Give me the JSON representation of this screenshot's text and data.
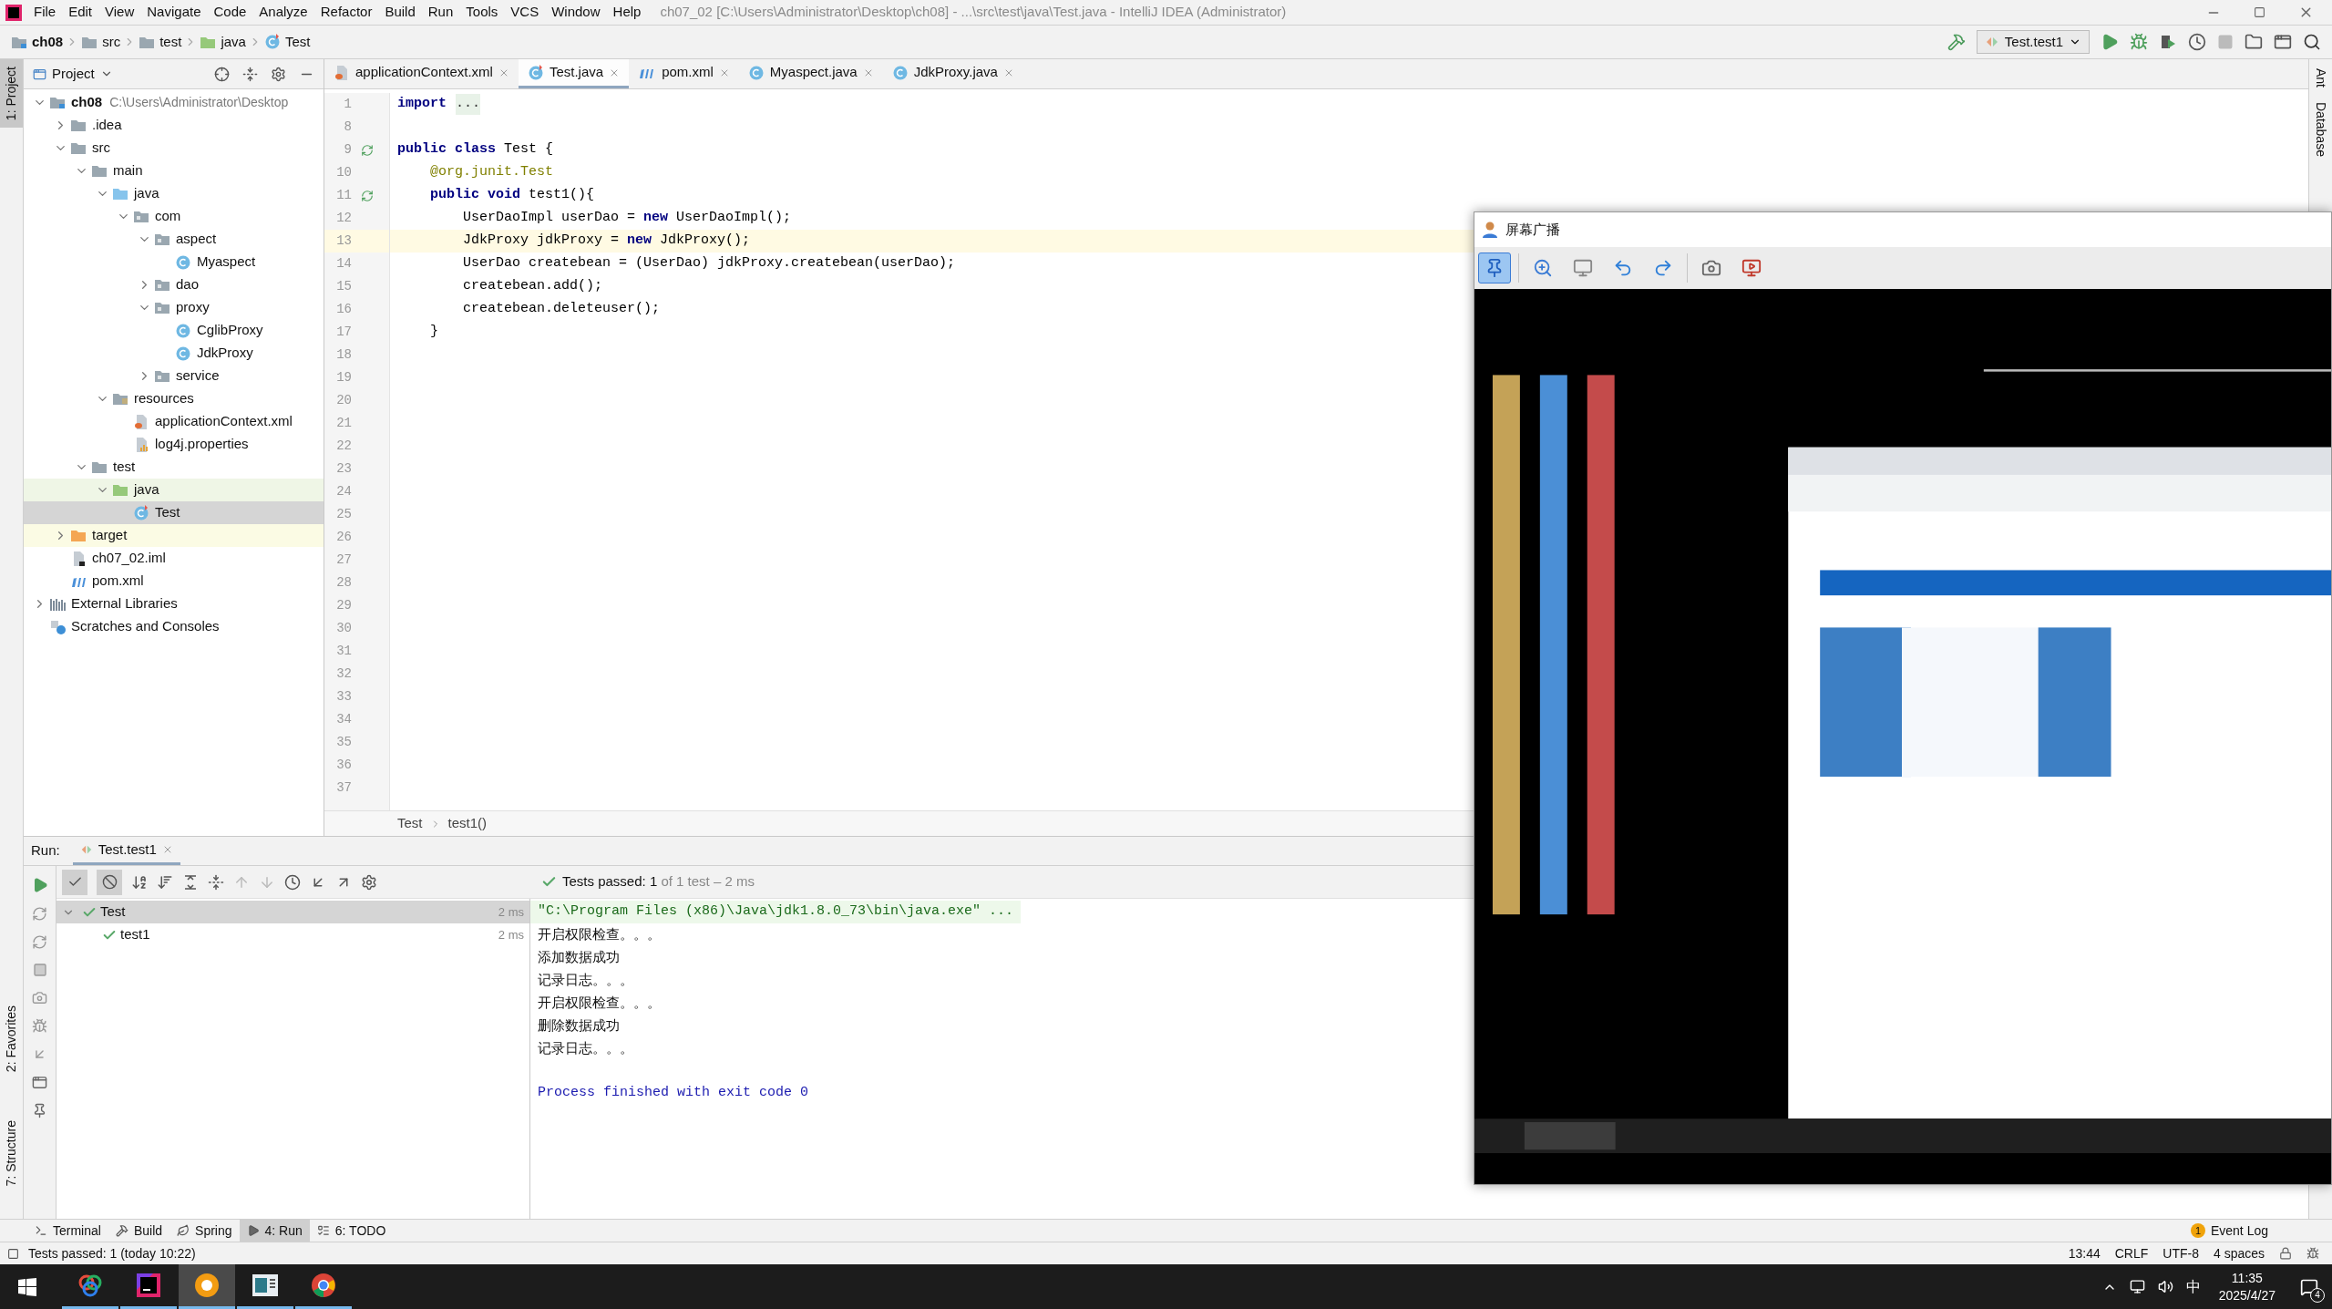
{
  "window": {
    "title": "ch07_02 [C:\\Users\\Administrator\\Desktop\\ch08] - ...\\src\\test\\java\\Test.java - IntelliJ IDEA (Administrator)"
  },
  "menu": [
    "File",
    "Edit",
    "View",
    "Navigate",
    "Code",
    "Analyze",
    "Refactor",
    "Build",
    "Run",
    "Tools",
    "VCS",
    "Window",
    "Help"
  ],
  "breadcrumbs": [
    {
      "label": "ch08",
      "kind": "module"
    },
    {
      "label": "src",
      "kind": "folder"
    },
    {
      "label": "test",
      "kind": "folder"
    },
    {
      "label": "java",
      "kind": "test_source"
    },
    {
      "label": "Test",
      "kind": "test_class"
    }
  ],
  "run_config": "Test.test1",
  "left_stripe": [
    {
      "label": "1: Project",
      "selected": true
    },
    {
      "label": "2: Favorites",
      "selected": false
    },
    {
      "label": "7: Structure",
      "selected": false
    }
  ],
  "right_stripe": [
    "Ant",
    "Database"
  ],
  "project_panel": {
    "title": "Project",
    "tree": [
      {
        "label": "ch08",
        "path": "C:\\Users\\Administrator\\Desktop",
        "kind": "module",
        "expanded": true,
        "selected": false,
        "children": [
          {
            "label": ".idea",
            "kind": "folder",
            "expanded": false,
            "selected": false
          },
          {
            "label": "src",
            "kind": "folder",
            "expanded": true,
            "selected": false,
            "children": [
              {
                "label": "main",
                "kind": "folder",
                "expanded": true,
                "selected": false,
                "children": [
                  {
                    "label": "java",
                    "kind": "source",
                    "expanded": true,
                    "selected": false,
                    "children": [
                      {
                        "label": "com",
                        "kind": "package",
                        "expanded": true,
                        "selected": false,
                        "children": [
                          {
                            "label": "aspect",
                            "kind": "package",
                            "expanded": true,
                            "selected": false,
                            "children": [
                              {
                                "label": "Myaspect",
                                "kind": "class",
                                "selected": false
                              }
                            ]
                          },
                          {
                            "label": "dao",
                            "kind": "package",
                            "expanded": false,
                            "selected": false
                          },
                          {
                            "label": "proxy",
                            "kind": "package",
                            "expanded": true,
                            "selected": false,
                            "children": [
                              {
                                "label": "CglibProxy",
                                "kind": "class",
                                "selected": false
                              },
                              {
                                "label": "JdkProxy",
                                "kind": "class",
                                "selected": false
                              }
                            ]
                          },
                          {
                            "label": "service",
                            "kind": "package",
                            "expanded": false,
                            "selected": false
                          }
                        ]
                      }
                    ]
                  },
                  {
                    "label": "resources",
                    "kind": "resources",
                    "expanded": true,
                    "selected": false,
                    "children": [
                      {
                        "label": "applicationContext.xml",
                        "kind": "xml",
                        "selected": false
                      },
                      {
                        "label": "log4j.properties",
                        "kind": "properties",
                        "selected": false
                      }
                    ]
                  }
                ]
              },
              {
                "label": "test",
                "kind": "folder",
                "expanded": true,
                "selected": false,
                "children": [
                  {
                    "label": "java",
                    "kind": "test_source",
                    "expanded": true,
                    "selected": false,
                    "color": "#eff6e6",
                    "children": [
                      {
                        "label": "Test",
                        "kind": "test_class",
                        "selected": true
                      }
                    ]
                  }
                ]
              }
            ]
          },
          {
            "label": "target",
            "kind": "excluded",
            "expanded": false,
            "selected": false,
            "color": "#fbfbe4"
          },
          {
            "label": "ch07_02.iml",
            "kind": "iml",
            "selected": false
          },
          {
            "label": "pom.xml",
            "kind": "pom",
            "selected": false
          }
        ]
      },
      {
        "label": "External Libraries",
        "kind": "libraries",
        "expanded": false,
        "selected": false
      },
      {
        "label": "Scratches and Consoles",
        "kind": "scratches",
        "selected": false
      }
    ]
  },
  "editor_tabs": [
    {
      "label": "applicationContext.xml",
      "kind": "xml",
      "selected": false
    },
    {
      "label": "Test.java",
      "kind": "test_class",
      "selected": true
    },
    {
      "label": "pom.xml",
      "kind": "pom",
      "selected": false
    },
    {
      "label": "Myaspect.java",
      "kind": "class",
      "selected": false
    },
    {
      "label": "JdkProxy.java",
      "kind": "class",
      "selected": false
    }
  ],
  "editor": {
    "lines": [
      {
        "number": "1",
        "run_icon": false,
        "current": false,
        "code": [
          {
            "text": "import",
            "kind": "keyword"
          },
          {
            "text": "...",
            "kind": "folded"
          }
        ]
      },
      {
        "number": "8",
        "run_icon": false,
        "current": false
      },
      {
        "number": "9",
        "run_icon": true,
        "current": false,
        "code": [
          {
            "text": "public class",
            "kind": "keyword"
          },
          {
            "text": " Test {"
          }
        ]
      },
      {
        "number": "10",
        "run_icon": false,
        "current": false,
        "code": [
          {
            "text": "    @org.junit.Test",
            "kind": "annotation"
          }
        ]
      },
      {
        "number": "11",
        "run_icon": true,
        "current": false,
        "code": [
          {
            "text": "    public void",
            "kind": "keyword"
          },
          {
            "text": " test1(){"
          }
        ]
      },
      {
        "number": "12",
        "run_icon": false,
        "current": false,
        "code": [
          {
            "text": "        UserDaoImpl userDao = "
          },
          {
            "text": "new",
            "kind": "keyword"
          },
          {
            "text": " UserDaoImpl();"
          }
        ]
      },
      {
        "number": "13",
        "run_icon": false,
        "current": true,
        "code": [
          {
            "text": "        JdkProxy jdkProxy = "
          },
          {
            "text": "new",
            "kind": "keyword"
          },
          {
            "text": " JdkProxy();"
          }
        ]
      },
      {
        "number": "14",
        "run_icon": false,
        "current": false,
        "code": [
          {
            "text": "        UserDao createbean = (UserDao) jdkProxy.createbean(userDao);"
          }
        ]
      },
      {
        "number": "15",
        "run_icon": false,
        "current": false,
        "code": [
          {
            "text": "        createbean.add();"
          }
        ]
      },
      {
        "number": "16",
        "run_icon": false,
        "current": false,
        "code": [
          {
            "text": "        createbean.deleteuser();"
          }
        ]
      },
      {
        "number": "17",
        "run_icon": false,
        "current": false,
        "code": [
          {
            "text": "    }"
          }
        ]
      },
      {
        "number": "18",
        "run_icon": false,
        "current": false
      },
      {
        "number": "19",
        "run_icon": false,
        "current": false
      },
      {
        "number": "20",
        "run_icon": false,
        "current": false
      },
      {
        "number": "21",
        "run_icon": false,
        "current": false
      },
      {
        "number": "22",
        "run_icon": false,
        "current": false
      },
      {
        "number": "23",
        "run_icon": false,
        "current": false
      },
      {
        "number": "24",
        "run_icon": false,
        "current": false
      },
      {
        "number": "25",
        "run_icon": false,
        "current": false
      },
      {
        "number": "26",
        "run_icon": false,
        "current": false
      },
      {
        "number": "27",
        "run_icon": false,
        "current": false
      },
      {
        "number": "28",
        "run_icon": false,
        "current": false
      },
      {
        "number": "29",
        "run_icon": false,
        "current": false
      },
      {
        "number": "30",
        "run_icon": false,
        "current": false
      },
      {
        "number": "31",
        "run_icon": false,
        "current": false
      },
      {
        "number": "32",
        "run_icon": false,
        "current": false
      },
      {
        "number": "33",
        "run_icon": false,
        "current": false
      },
      {
        "number": "34",
        "run_icon": false,
        "current": false
      },
      {
        "number": "35",
        "run_icon": false,
        "current": false
      },
      {
        "number": "36",
        "run_icon": false,
        "current": false
      },
      {
        "number": "37",
        "run_icon": false,
        "current": false
      }
    ],
    "breadcrumb": [
      "Test",
      "test1()"
    ]
  },
  "run_panel": {
    "label": "Run:",
    "tab": "Test.test1",
    "passed": "Tests passed: 1",
    "detail": "of 1 test – 2 ms",
    "tests": [
      {
        "name": "Test",
        "time": "2 ms",
        "selected": true,
        "expanded": true,
        "children": [
          {
            "name": "test1",
            "time": "2 ms",
            "selected": false
          }
        ]
      }
    ],
    "console": [
      {
        "text": "\"C:\\Program Files (x86)\\Java\\jdk1.8.0_73\\bin\\java.exe\" ...",
        "kind": "command"
      },
      {
        "text": "开启权限检查。。。",
        "kind": "output"
      },
      {
        "text": "添加数据成功",
        "kind": "output"
      },
      {
        "text": "记录日志。。。",
        "kind": "output"
      },
      {
        "text": "开启权限检查。。。",
        "kind": "output"
      },
      {
        "text": "删除数据成功",
        "kind": "output"
      },
      {
        "text": "记录日志。。。",
        "kind": "output"
      },
      {
        "text": "Process finished with exit code 0",
        "kind": "exit"
      }
    ]
  },
  "broadcast_window": {
    "title": "屏幕广播",
    "tools": [
      {
        "kind": "pin",
        "selected": true
      },
      {
        "kind": "zoom",
        "selected": false
      },
      {
        "kind": "monitor",
        "selected": false
      },
      {
        "kind": "undo",
        "selected": false
      },
      {
        "kind": "redo",
        "selected": false
      },
      {
        "kind": "camera",
        "selected": false
      },
      {
        "kind": "record",
        "selected": false
      }
    ]
  },
  "bottom_tabs": [
    {
      "label": "Terminal",
      "kind": "terminal",
      "selected": false
    },
    {
      "label": "Build",
      "kind": "build",
      "selected": false
    },
    {
      "label": "Spring",
      "kind": "spring",
      "selected": false
    },
    {
      "label": "4: Run",
      "kind": "run",
      "selected": true
    },
    {
      "label": "6: TODO",
      "kind": "todo",
      "selected": false
    }
  ],
  "event_log": {
    "count": "1",
    "label": "Event Log"
  },
  "status_bar": {
    "message": "Tests passed: 1 (today 10:22)",
    "items": [
      "13:44",
      "CRLF",
      "UTF-8",
      "4 spaces"
    ]
  },
  "taskbar": {
    "apps": [
      {
        "kind": "wheel",
        "selected": false
      },
      {
        "kind": "ide",
        "selected": false
      },
      {
        "kind": "ring",
        "selected": true
      },
      {
        "kind": "board",
        "selected": false
      },
      {
        "kind": "browser",
        "selected": false
      }
    ],
    "ime": "中",
    "time": "11:35",
    "date": "2025/4/27",
    "notifications": "4"
  }
}
